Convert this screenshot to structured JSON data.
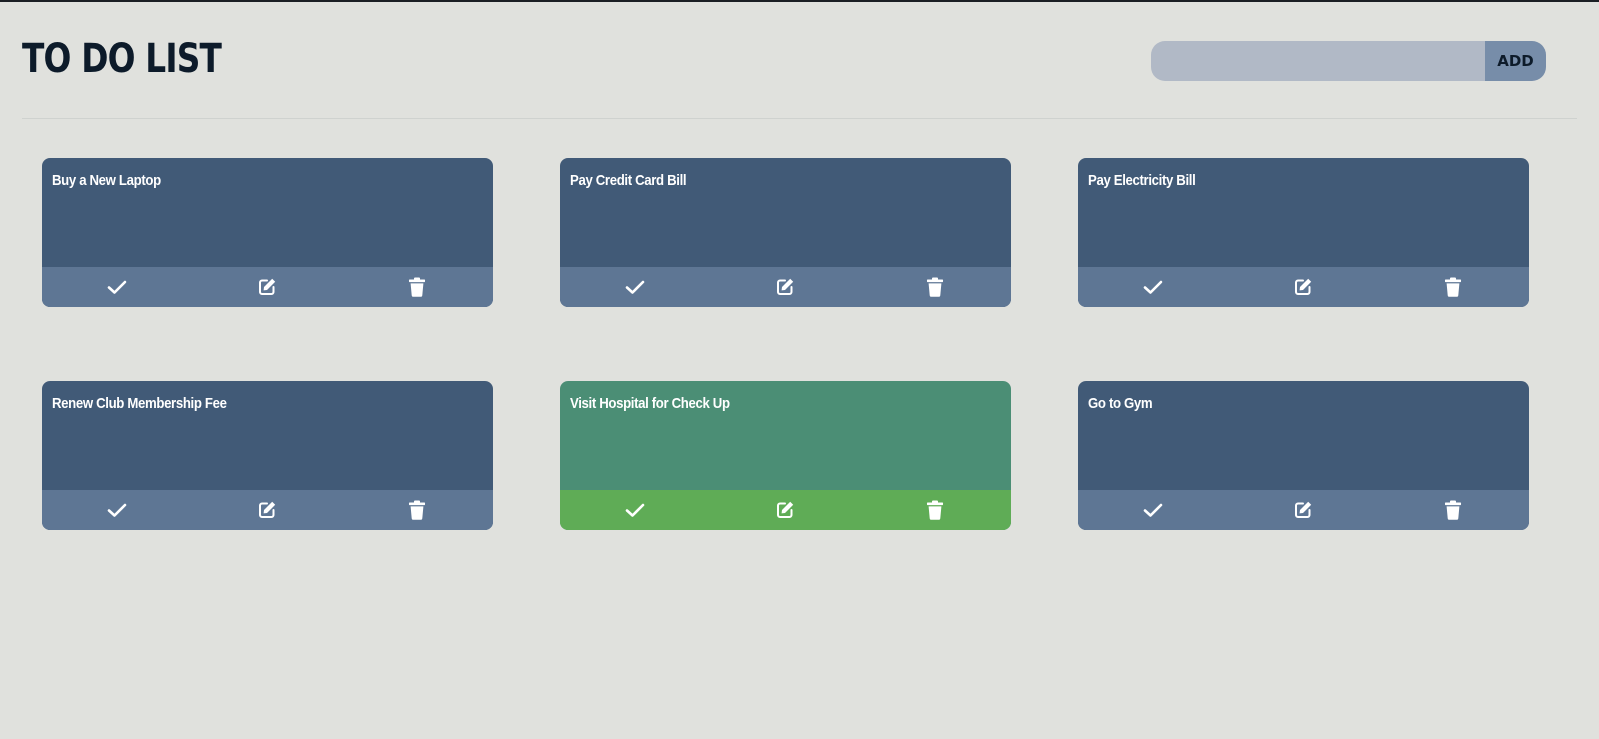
{
  "app": {
    "title": "TO DO LIST"
  },
  "add_form": {
    "input_value": "",
    "button_label": "ADD"
  },
  "tasks": [
    {
      "text": "Buy a New Laptop",
      "completed": false
    },
    {
      "text": "Pay Credit Card Bill",
      "completed": false
    },
    {
      "text": "Pay Electricity Bill",
      "completed": false
    },
    {
      "text": "Renew Club Membership Fee",
      "completed": false
    },
    {
      "text": "Visit Hospital for Check Up",
      "completed": true
    },
    {
      "text": "Go to Gym",
      "completed": false
    }
  ],
  "icons": {
    "complete": "check-icon",
    "edit": "edit-icon",
    "delete": "trash-icon"
  },
  "colors": {
    "background": "#e0e1dd",
    "title": "#0d1b2a",
    "card": "#415a77",
    "card_actions": "#5e7694",
    "card_done": "#4b8e75",
    "card_done_actions": "#5fac56",
    "input": "#b1b9c6",
    "button": "#778da9"
  }
}
